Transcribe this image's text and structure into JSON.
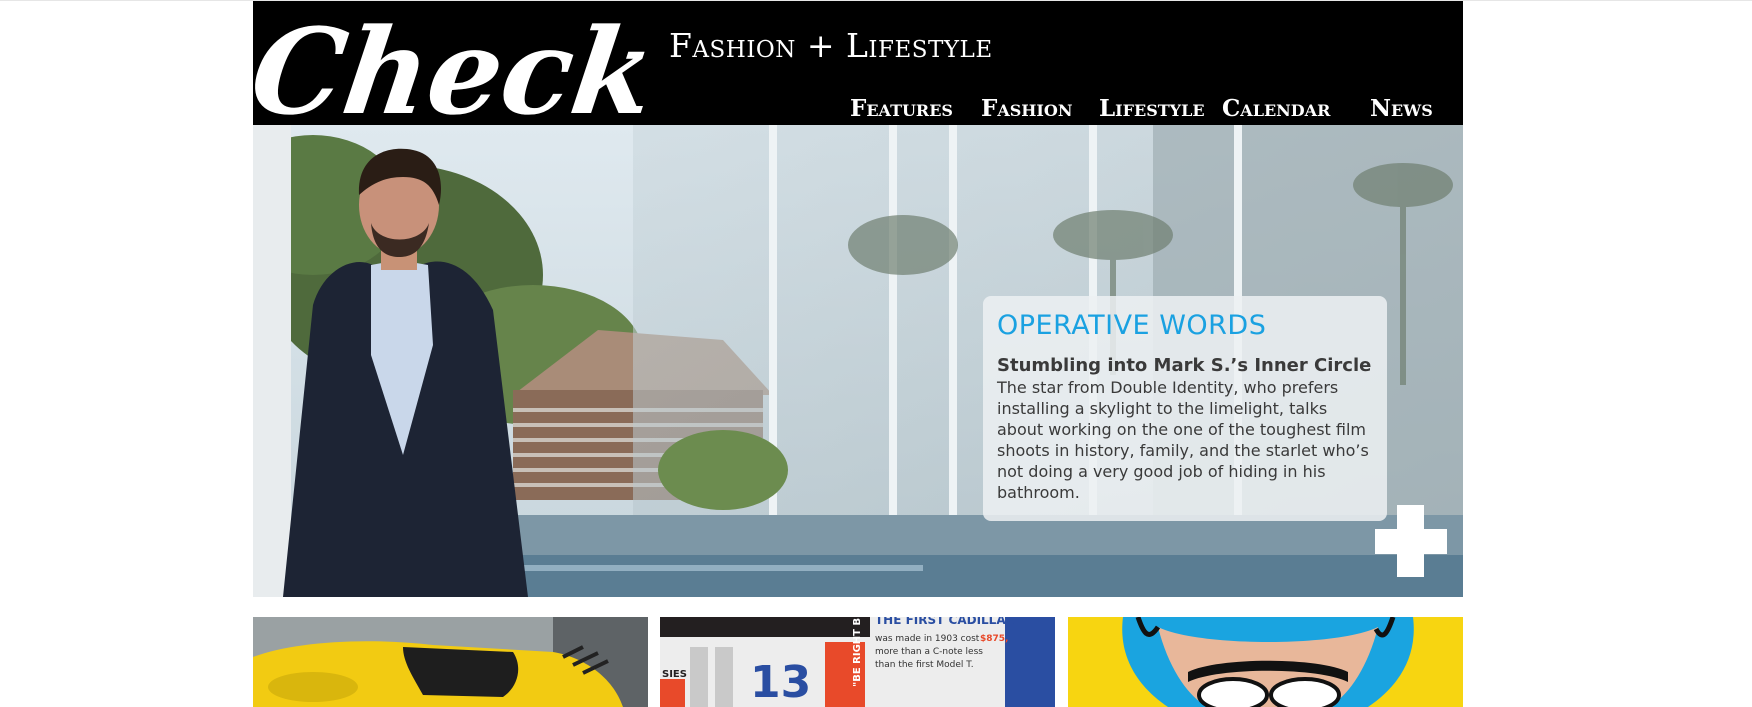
{
  "brand": {
    "logo_text": "Check",
    "tagline": "Fashion + Lifestyle"
  },
  "nav": {
    "items": [
      {
        "label": "Features"
      },
      {
        "label": "Fashion"
      },
      {
        "label": "Lifestyle"
      },
      {
        "label": "Calendar"
      },
      {
        "label": "News"
      }
    ]
  },
  "hero": {
    "kicker": "OPERATIVE WORDS",
    "title": "Stumbling into Mark S.’s Inner Circle",
    "body": "The star from Double Identity, who prefers installing a skylight to the limelight, talks about working on the one of the toughest film shoots in history, family, and the starlet who’s not doing a very good job of hiding in his bathroom.",
    "more_icon": "plus-icon"
  },
  "thumbnails": [
    {
      "name": "yellow-car",
      "text": []
    },
    {
      "name": "infographic",
      "text": [
        "THE FIRST CADILLAC",
        "was made in 1903 cost",
        "$875,",
        "more than a C-note less",
        "than the first Model T.",
        "13",
        "\"BE RIGHT B",
        "SIES"
      ]
    },
    {
      "name": "pop-art-helmet",
      "text": []
    }
  ],
  "colors": {
    "header_bg": "#000000",
    "accent": "#1aa1e1",
    "page_bg": "#ffffff",
    "thumb_yellow": "#f7d511"
  }
}
